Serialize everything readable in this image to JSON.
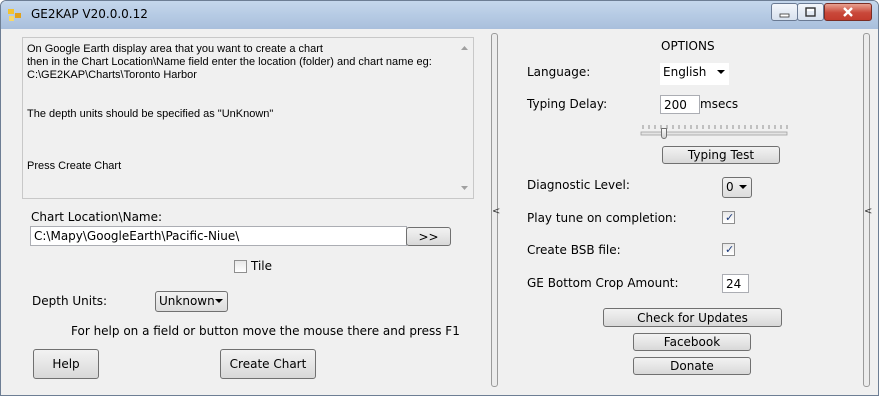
{
  "window": {
    "title": "GE2KAP V20.0.0.12"
  },
  "instructions": {
    "lines": [
      "On Google Earth display area that you want to create a chart",
      "then in the Chart Location\\Name field enter the location (folder) and chart name eg:",
      "C:\\GE2KAP\\Charts\\Toronto Harbor",
      "",
      "",
      "The depth units should be specified as \"UnKnown\"",
      "",
      "",
      "",
      "Press Create Chart"
    ]
  },
  "left": {
    "chart_location_label": "Chart Location\\Name:",
    "chart_location_value": "C:\\Mapy\\GoogleEarth\\Pacific-Niue\\",
    "browse_label": ">>",
    "tile_label": "Tile",
    "tile_checked": false,
    "depth_units_label": "Depth Units:",
    "depth_units_value": "Unknown",
    "help_hint": "For help on a field or button move the mouse there and press F1",
    "help_button": "Help",
    "create_chart_button": "Create Chart"
  },
  "options": {
    "heading": "OPTIONS",
    "language_label": "Language:",
    "language_value": "English",
    "typing_delay_label": "Typing Delay:",
    "typing_delay_value": "200",
    "typing_delay_unit": "msecs",
    "typing_delay_slider_fraction": 0.14,
    "typing_test_button": "Typing Test",
    "diagnostic_label": "Diagnostic Level:",
    "diagnostic_value": "0",
    "play_tune_label": "Play tune on completion:",
    "play_tune_checked": true,
    "create_bsb_label": "Create BSB file:",
    "create_bsb_checked": true,
    "crop_label": "GE Bottom Crop Amount:",
    "crop_value": "24",
    "check_updates_button": "Check for Updates",
    "facebook_button": "Facebook",
    "donate_button": "Donate"
  },
  "splitters": {
    "left_arrow": "<",
    "right_arrow": "<"
  },
  "icons": {
    "app": "ge2kap-app-icon",
    "minimize": "minimize-icon",
    "maximize": "maximize-icon",
    "close": "close-icon"
  }
}
